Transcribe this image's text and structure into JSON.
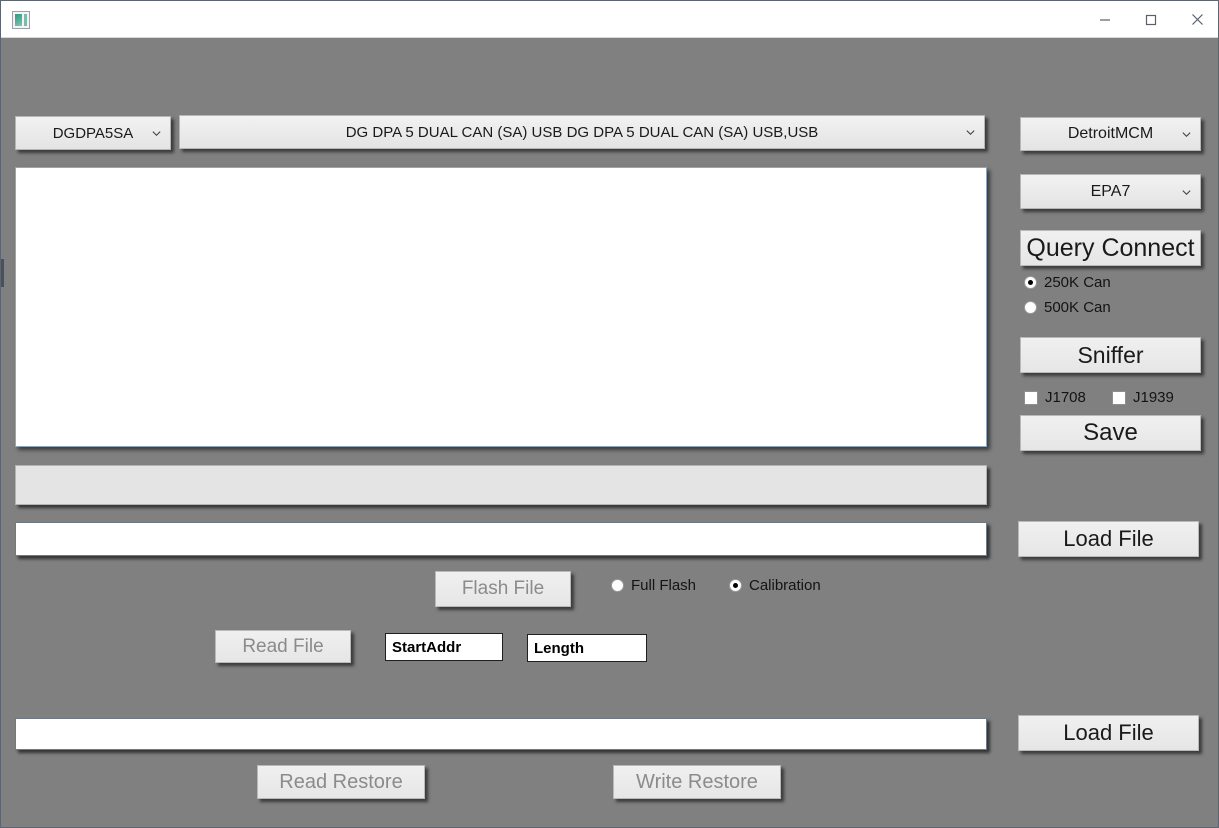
{
  "window": {
    "title": "",
    "background_color": "#808080",
    "icon_name": "app-icon",
    "controls": {
      "minimize_label": "—",
      "maximize_label": "□",
      "close_label": "✕"
    }
  },
  "toolbar": {
    "adapter_combo": {
      "value": "DGDPA5SA",
      "caret": "⌄"
    },
    "device_combo": {
      "value": "DG DPA 5 DUAL CAN (SA) USB DG DPA 5 DUAL CAN (SA) USB,USB",
      "caret": "⌄"
    }
  },
  "sidebar": {
    "ecu_combo": {
      "value": "DetroitMCM",
      "caret": "⌄"
    },
    "emission_combo": {
      "value": "EPA7",
      "caret": "⌄"
    },
    "query_connect_button": "Query Connect",
    "baud_options": [
      {
        "label": "250K Can",
        "selected": true
      },
      {
        "label": "500K Can",
        "selected": false
      }
    ],
    "sniffer_button": "Sniffer",
    "protocol_checkboxes": [
      {
        "label": "J1708",
        "checked": false
      },
      {
        "label": "J1939",
        "checked": false
      }
    ],
    "save_button": "Save",
    "load_file_button_flash": "Load File",
    "load_file_button_restore": "Load File"
  },
  "main": {
    "log_area_value": "",
    "progress_value": "",
    "flash_path_value": "",
    "flash_path_placeholder": "",
    "flash_file_button": {
      "label": "Flash File",
      "enabled": false
    },
    "flash_mode_options": [
      {
        "label": "Full Flash",
        "selected": false
      },
      {
        "label": "Calibration",
        "selected": true
      }
    ],
    "read_file_button": {
      "label": "Read File",
      "enabled": false
    },
    "start_addr_field": {
      "value": "StartAddr"
    },
    "length_field": {
      "value": "Length"
    },
    "restore_path_value": "",
    "read_restore_button": {
      "label": "Read Restore",
      "enabled": false
    },
    "write_restore_button": {
      "label": "Write Restore",
      "enabled": false
    }
  }
}
